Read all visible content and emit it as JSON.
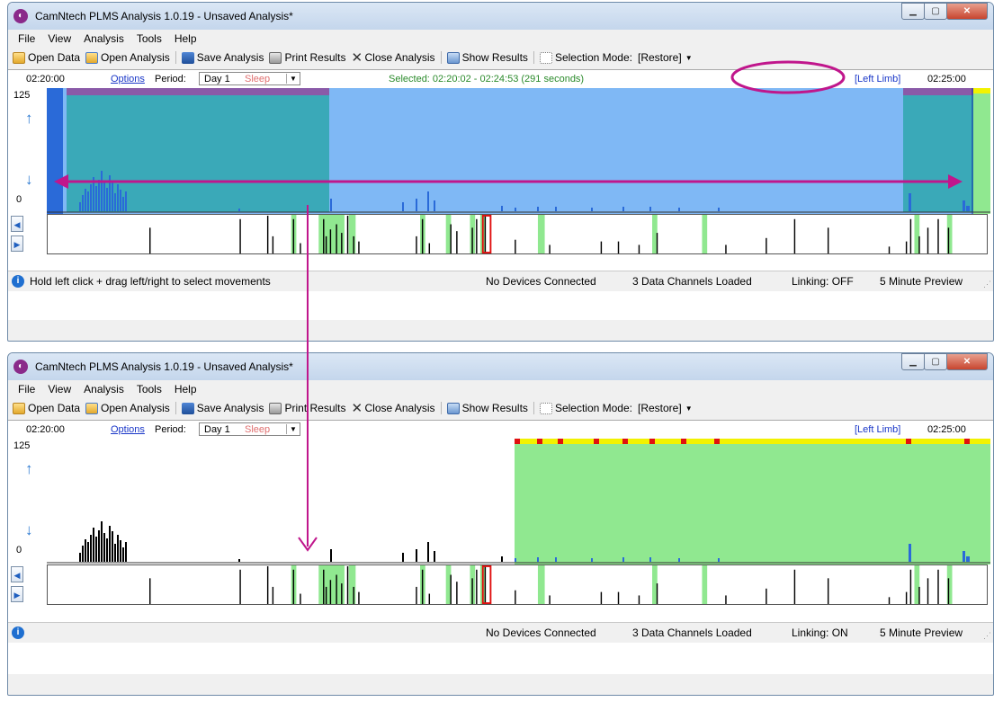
{
  "windows": [
    {
      "title": "CamNtech PLMS Analysis 1.0.19 - Unsaved Analysis*",
      "menu": [
        "File",
        "View",
        "Analysis",
        "Tools",
        "Help"
      ],
      "toolbar": {
        "open_data": "Open Data",
        "open_analysis": "Open Analysis",
        "save_analysis": "Save Analysis",
        "print_results": "Print Results",
        "close_analysis": "Close Analysis",
        "show_results": "Show Results",
        "selection_mode": "Selection Mode:",
        "restore": "[Restore]"
      },
      "info": {
        "time_left": "02:20:00",
        "options": "Options",
        "period_label": "Period:",
        "day": "Day 1",
        "sleep": "Sleep",
        "selected": "Selected: 02:20:02 - 02:24:53 (291 seconds)",
        "limb": "[Left Limb]",
        "time_right": "02:25:00"
      },
      "y_top": "125",
      "y_bottom": "0",
      "status": {
        "message": "Hold left click + drag left/right to select movements",
        "devices": "No Devices Connected",
        "channels": "3 Data Channels Loaded",
        "linking": "Linking: OFF",
        "preview": "5 Minute Preview"
      }
    },
    {
      "title": "CamNtech PLMS Analysis 1.0.19 - Unsaved Analysis*",
      "menu": [
        "File",
        "View",
        "Analysis",
        "Tools",
        "Help"
      ],
      "toolbar": {
        "open_data": "Open Data",
        "open_analysis": "Open Analysis",
        "save_analysis": "Save Analysis",
        "print_results": "Print Results",
        "close_analysis": "Close Analysis",
        "show_results": "Show Results",
        "selection_mode": "Selection Mode:",
        "restore": "[Restore]"
      },
      "info": {
        "time_left": "02:20:00",
        "options": "Options",
        "period_label": "Period:",
        "day": "Day 1",
        "sleep": "Sleep",
        "selected": "",
        "limb": "[Left Limb]",
        "time_right": "02:25:00"
      },
      "y_top": "125",
      "y_bottom": "0",
      "status": {
        "message": "",
        "devices": "No Devices Connected",
        "channels": "3 Data Channels Loaded",
        "linking": "Linking: ON",
        "preview": "5 Minute Preview"
      }
    }
  ],
  "icons": {
    "app": "camntech-app-icon",
    "minimize": "minimize-icon",
    "maximize": "maximize-icon",
    "close": "close-icon",
    "info": "info-icon",
    "nav_left": "chevron-left-icon",
    "nav_right": "chevron-right-icon"
  },
  "colors": {
    "selection_blue": "#7fb8f5",
    "sleep_teal": "#3aa9b8",
    "wake_green": "#90e890",
    "movement_blue": "#2a6ad8",
    "movement_black": "#000000",
    "annotation_magenta": "#c0168c",
    "marker_red": "#e01010",
    "marker_yellow": "#f2f200"
  }
}
